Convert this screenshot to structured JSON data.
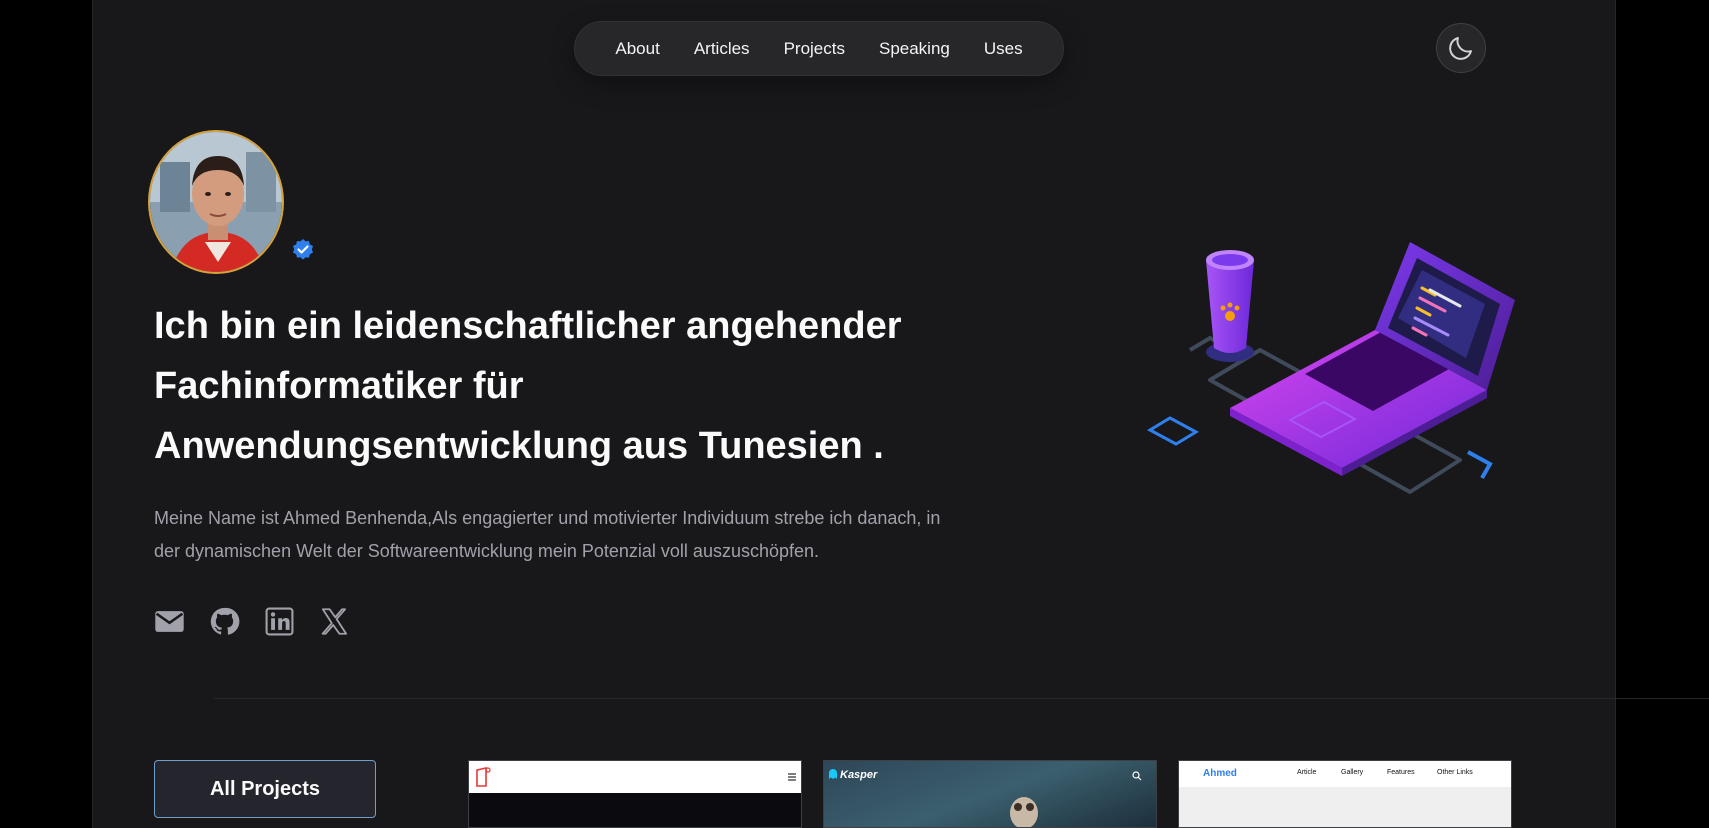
{
  "nav": {
    "items": [
      "About",
      "Articles",
      "Projects",
      "Speaking",
      "Uses"
    ]
  },
  "theme_toggle": {
    "icon": "moon-icon"
  },
  "hero": {
    "headline_lines": [
      "Ich bin ein leidenschaftlicher angehender",
      "Fachinformatiker für",
      "Anwendungsentwicklung aus Tunesien ."
    ],
    "intro_lines": [
      "Meine Name ist Ahmed Benhenda,Als engagierter und motivierter Individuum strebe ich danach, in",
      "der dynamischen Welt der Softwareentwicklung mein Potenzial voll auszuschöpfen."
    ],
    "socials": [
      "mail-icon",
      "github-icon",
      "linkedin-icon",
      "x-icon"
    ]
  },
  "projects": {
    "all_projects_label": "All Projects",
    "thumb2_brand": "Kasper",
    "thumb3_brand": "Ahmed",
    "thumb3_links": [
      "Article",
      "Gallery",
      "Features",
      "Other Links"
    ]
  },
  "colors": {
    "background": "#18181b",
    "nav_bg": "#27272a",
    "accent_blue": "#2f80ed",
    "avatar_border": "#d6a23a"
  }
}
